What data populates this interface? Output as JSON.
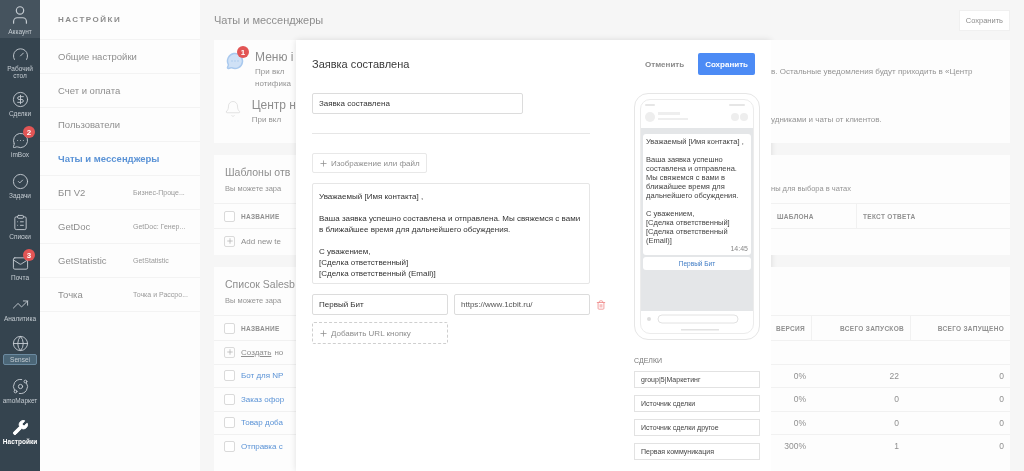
{
  "nav": [
    {
      "label": "Аккаунт",
      "kind": "account",
      "selected": false
    },
    {
      "label": "Рабочий стол",
      "kind": "plain",
      "selected": false
    },
    {
      "label": "Сделки",
      "kind": "plain",
      "selected": false
    },
    {
      "label": "imBox",
      "kind": "plain",
      "badge": "2",
      "selected": false
    },
    {
      "label": "Задачи",
      "kind": "plain",
      "selected": false
    },
    {
      "label": "Списки",
      "kind": "plain",
      "selected": false
    },
    {
      "label": "Почта",
      "kind": "plain",
      "badge": "3",
      "selected": false
    },
    {
      "label": "Аналитика",
      "kind": "plain",
      "selected": false
    },
    {
      "label": "Sensei",
      "kind": "tag",
      "selected": false
    },
    {
      "label": "amoМаркет",
      "kind": "plain",
      "selected": false
    },
    {
      "label": "Настройки",
      "kind": "plain",
      "selected": true
    }
  ],
  "settings": {
    "title": "НАСТРОЙКИ",
    "items": [
      {
        "label": "Общие настройки",
        "selected": false
      },
      {
        "label": "Счет и оплата",
        "selected": false
      },
      {
        "label": "Пользователи",
        "selected": false
      },
      {
        "label": "Чаты и мессенджеры",
        "selected": true
      },
      {
        "label": "БП V2",
        "note": "Бизнес-Проце...",
        "selected": false
      },
      {
        "label": "GetDoc",
        "note": "GetDoc: Генер...",
        "selected": false
      },
      {
        "label": "GetStatistic",
        "note": "GetStatistic",
        "selected": false
      },
      {
        "label": "Точка",
        "note": "Точка и Рассро...",
        "selected": false
      }
    ]
  },
  "page": {
    "title": "Чаты и мессенджеры",
    "save_button": "Сохранить"
  },
  "notifications": [
    {
      "title": "Меню i",
      "lines": [
        "При вкл",
        "нотифика"
      ],
      "tail": "в. Остальные уведомления будут приходить в «Центр",
      "badge": "1"
    },
    {
      "title": "Центр н",
      "lines": [
        "При вкл"
      ],
      "tail": "удниками и чаты от клиентов."
    }
  ],
  "templates": {
    "title": "Шаблоны отв",
    "subtitle": "Вы можете зара",
    "subtitle_tail": "ны для выбора в чатах",
    "columns": [
      "НАЗВАНИЕ",
      "ШАБЛОНА",
      "ТЕКСТ ОТВЕТА"
    ],
    "all_checked": false,
    "add_label": "Add new te"
  },
  "bots": {
    "title": "Список Salesb",
    "subtitle": "Вы можете зара",
    "columns": [
      "НАЗВАНИЕ",
      "ВЕРСИЯ",
      "ВСЕГО ЗАПУСКОВ",
      "ВСЕГО ЗАПУЩЕНО"
    ],
    "all_checked": false,
    "create_link": "Создать",
    "create_rest": "но",
    "rows": [
      {
        "name": "Бот для NP",
        "checked": false,
        "conversion": "0%",
        "runs": "22",
        "launched": "0"
      },
      {
        "name": "Заказ офор",
        "checked": false,
        "conversion": "0%",
        "runs": "0",
        "launched": "0"
      },
      {
        "name": "Товар доба",
        "checked": false,
        "conversion": "0%",
        "runs": "0",
        "launched": "0"
      },
      {
        "name": "Отправка с",
        "checked": false,
        "conversion": "300%",
        "runs": "1",
        "launched": "0"
      }
    ]
  },
  "modal": {
    "title": "Заявка составлена",
    "cancel": "Отменить",
    "save": "Сохранить",
    "name_value": "Заявка составлена",
    "attach_label": "Изображение или файл",
    "message": "Уважаемый [Имя контакта] ,\n\nВаша заявка успешно составлена и отправлена. Мы свяжемся с вами в ближайшее время для дальнейшего обсуждения.\n\nС уважением,\n[Сделка ответственный]\n[Сделка ответственный (Email)]",
    "url_buttons": [
      {
        "label": "Первый Бит",
        "url": "https://www.1cbit.ru/"
      }
    ],
    "add_url_label": "Добавить URL кнопку",
    "preview": {
      "message": "Уважаемый [Имя контакта] ,\n\nВаша заявка успешно составлена и отправлена. Мы свяжемся с вами в ближайшее время для дальнейшего обсуждения.\n\nС уважением,\n[Сделка ответственный]\n[Сделка ответственный (Email)]",
      "time": "14:45",
      "button": "Первый Бит"
    },
    "deals": {
      "title": "СДЕЛКИ",
      "fields": [
        "group|5|Маркетинг",
        "Источник сделки",
        "Источник сделки другое",
        "Первая коммуникация"
      ]
    }
  }
}
